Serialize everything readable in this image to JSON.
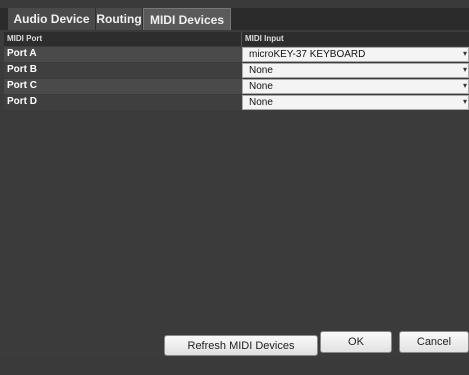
{
  "tabs": [
    {
      "label": "Audio Device"
    },
    {
      "label": "Routing"
    },
    {
      "label": "MIDI Devices",
      "active": true
    }
  ],
  "table": {
    "columns": [
      "MIDI Port",
      "MIDI Input"
    ],
    "rows": [
      {
        "port": "Port A",
        "input": "microKEY-37 KEYBOARD"
      },
      {
        "port": "Port B",
        "input": "None"
      },
      {
        "port": "Port C",
        "input": "None"
      },
      {
        "port": "Port D",
        "input": "None"
      }
    ]
  },
  "buttons": {
    "refresh": "Refresh MIDI Devices",
    "ok": "OK",
    "cancel": "Cancel"
  },
  "icons": {
    "dropdown": "chevron-down-icon"
  }
}
